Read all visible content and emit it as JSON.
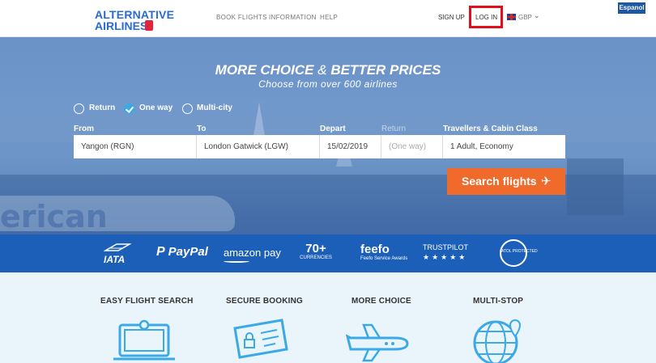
{
  "header": {
    "logo_line1": "ALTERNATIVE",
    "logo_line2": "AIRLINES",
    "nav": [
      "BOOK FLIGHTS",
      "INFORMATION",
      "HELP"
    ],
    "sign_up": "SIGN UP",
    "log_in": "LOG IN",
    "currency": "GBP",
    "language_button": "Espanol"
  },
  "hero": {
    "headline_part1": "MORE CHOICE",
    "headline_amp": "&",
    "headline_part2": "BETTER PRICES",
    "subheadline": "Choose from over 600 airlines",
    "trip_types": [
      {
        "label": "Return",
        "checked": false
      },
      {
        "label": "One way",
        "checked": true
      },
      {
        "label": "Multi-city",
        "checked": false
      }
    ],
    "fields": {
      "from_label": "From",
      "from_value": "Yangon (RGN)",
      "to_label": "To",
      "to_value": "London Gatwick (LGW)",
      "depart_label": "Depart",
      "depart_value": "15/02/2019",
      "return_label": "Return",
      "return_value": "(One way)",
      "travellers_label": "Travellers & Cabin Class",
      "travellers_value": "1 Adult, Economy"
    },
    "search_button": "Search flights",
    "background_text": "erican"
  },
  "partners": {
    "iata": "IATA",
    "paypal": "PayPal",
    "amazon": "amazon pay",
    "currencies_count": "70+",
    "currencies_label": "CURRENCIES",
    "feefo": "feefo",
    "feefo_sub": "Feefo Service Awards",
    "trustpilot": "TRUSTPILOT",
    "trustpilot_stars": "★★★★★",
    "atol": "ATOL PROTECTED"
  },
  "features": [
    {
      "title": "EASY FLIGHT SEARCH",
      "icon": "laptop-icon"
    },
    {
      "title": "SECURE BOOKING",
      "icon": "ticket-icon"
    },
    {
      "title": "MORE CHOICE",
      "icon": "airplane-icon"
    },
    {
      "title": "MULTI-STOP",
      "icon": "globe-icon"
    }
  ],
  "colors": {
    "brand_blue": "#2a6bd1",
    "band_blue": "#1c5fb8",
    "search_orange": "#f06a2b",
    "highlight_red": "#e0101a"
  }
}
